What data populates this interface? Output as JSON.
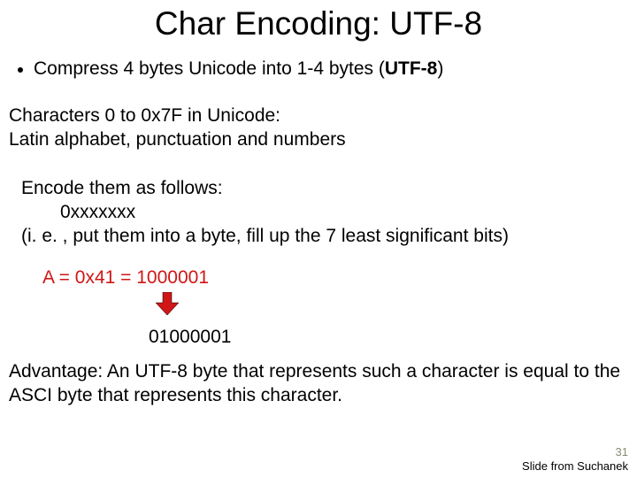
{
  "title": "Char Encoding: UTF-8",
  "bullet": {
    "pre": "Compress 4 bytes Unicode into 1-4 bytes (",
    "bold": "UTF-8",
    "post": ")"
  },
  "range": {
    "line1_pre": "Characters   ",
    "line1_mid": "0 to 0x7F",
    "line1_post": "   in Unicode:",
    "line2": "Latin alphabet, punctuation and numbers"
  },
  "encode": {
    "line1": "Encode them as follows:",
    "pattern": "0xxxxxxx",
    "line3": "(i. e. , put them into a byte, fill up the 7 least significant bits)"
  },
  "example": {
    "red": "A = 0x41 = 1000001",
    "binary": "01000001"
  },
  "advantage": "Advantage: An UTF-8 byte that represents such a character is equal to the ASCI byte that represents this character.",
  "footer": {
    "num": "31",
    "credit": "Slide from Suchanek"
  }
}
